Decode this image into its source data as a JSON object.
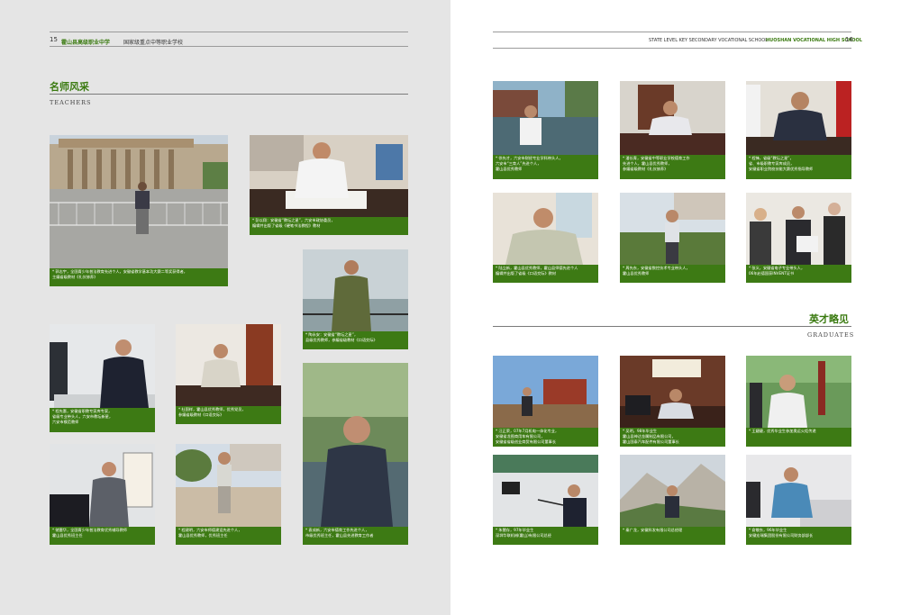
{
  "left_page": {
    "page_number": "15",
    "school_name": "霍山县高级职业中学",
    "school_tag": "国家级重点中等职业学校",
    "section_title": "名师风采",
    "section_subtitle": "TEACHERS",
    "cards": [
      {
        "lines": [
          "* 郭志宇，全国青少年普法教育先进个人，安徽省教学基本功大赛二等奖获得者，",
          "主编省级教材《礼仪修养》"
        ]
      },
      {
        "lines": [
          "* 彭以翔：安徽省“教坛之星”，六安市政协委员，",
          "编辑并出版了省级《硬笔书法教程》教材"
        ]
      },
      {
        "lines": [
          "* 陶永安：安徽省“教坛之星”，",
          "县级优秀教师，参编省级教材《口语交际》"
        ]
      },
      {
        "lines": [
          "* 程先惠，安徽省职教专家库专家，",
          "省级专业带头人，六安市教坛新星，",
          "六安市模范教师"
        ]
      },
      {
        "lines": [
          "* 杜国祥，霍山县优秀教师，优秀党员，",
          "参编省级教材《口语交际》"
        ]
      },
      {
        "lines": [
          "* 储雷华，全国青少年普法教育优秀辅导教师",
          "霍山县优秀班主任"
        ]
      },
      {
        "lines": [
          "* 程建明，六安市师德建设先进个人，",
          "霍山县优秀教师，优秀班主任"
        ]
      },
      {
        "lines": [
          "* 袁成新，六安市德育工作先进个人，",
          "市级优秀班主任，霍山县先进教育工作者"
        ]
      }
    ]
  },
  "right_page": {
    "page_number": "16",
    "header_en": "STATE LEVEL KEY SECONDARY VOCATIONAL SCHOOL",
    "header_school": "HUOSHAN VOCATIONAL HIGH SCHOOL",
    "teacher_cards": [
      {
        "lines": [
          "* 徐先才，六安市财经专业学科带头人，",
          "六安市“三育人”先进个人，",
          "霍山县优秀教师"
        ]
      },
      {
        "lines": [
          "* 潘长青，安徽省中等职业学校德育工作",
          "先进个人，霍山县优秀教师，",
          "参编省级教材《礼仪修养》"
        ]
      },
      {
        "lines": [
          "* 程锋，省级“教坛之星”，",
          "省、市级职教专家库成员，",
          "安徽省职业院校技能大赛优秀指导教师"
        ]
      },
      {
        "lines": [
          "* 陆立新，霍山县优秀教师，霍山县师德先进个人",
          "编辑并出版了省级《口语交际》教材"
        ]
      },
      {
        "lines": [
          "* 周先东，安徽省数控技术专业带头人，",
          "霍山县优秀教师"
        ]
      },
      {
        "lines": [
          "* 张义，安徽省电子专业带头人，",
          "06年赴德国获INVENT证书"
        ]
      }
    ],
    "section_title": "英才略见",
    "section_subtitle": "GRADUATES",
    "graduate_cards": [
      {
        "lines": [
          "* 汪正荣，07年7月机电一体化专业，",
          "安徽省龙图商用车有限公司，",
          "安徽省省级创业商贸有限公司董事长"
        ]
      },
      {
        "lines": [
          "* 吴明，98年毕业生",
          "霍山县神达金属制品有限公司，",
          "霍山国泰汽车配件有限公司董事长"
        ]
      },
      {
        "lines": [
          "* 王婕婕，优秀毕业生参加奥运火炬传递"
        ]
      },
      {
        "lines": [
          "* 朱慧存，97年毕业生",
          "深圳华联机械(霍山)有限公司总经"
        ]
      },
      {
        "lines": [
          "* 秦广龙，安徽科发有限公司总经理"
        ]
      },
      {
        "lines": [
          "* 俞敬东，96年毕业生",
          "安徽宏瑞集团股份有限公司财务部部长"
        ]
      }
    ]
  }
}
